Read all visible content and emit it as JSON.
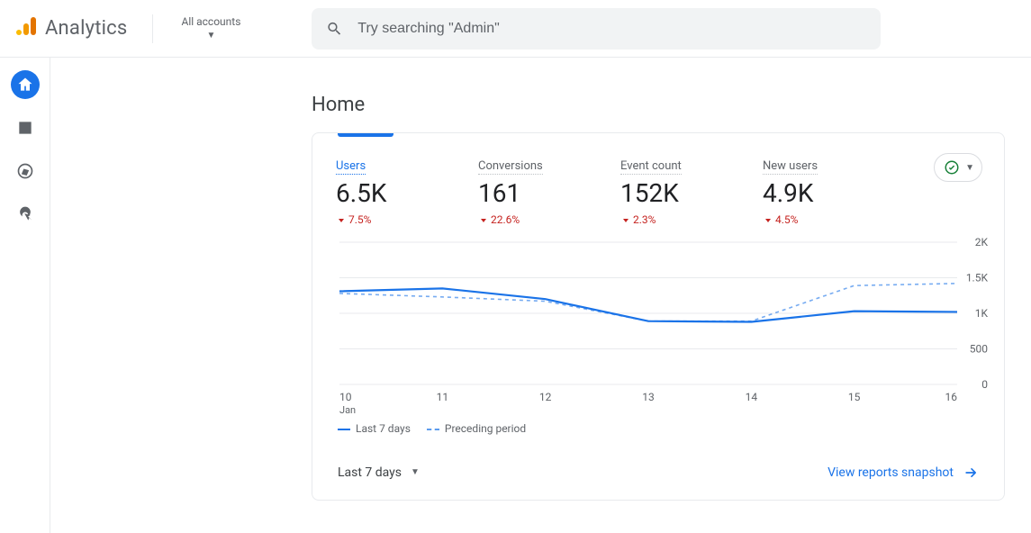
{
  "header": {
    "brand": "Analytics",
    "account_label": "All accounts",
    "search_placeholder": "Try searching \"Admin\""
  },
  "sidebar": {
    "items": [
      {
        "name": "home",
        "active": true
      },
      {
        "name": "reports",
        "active": false
      },
      {
        "name": "explore",
        "active": false
      },
      {
        "name": "advertising",
        "active": false
      }
    ]
  },
  "page": {
    "title": "Home"
  },
  "card": {
    "metrics": [
      {
        "label": "Users",
        "value": "6.5K",
        "delta": "7.5%",
        "direction": "down",
        "selected": true
      },
      {
        "label": "Conversions",
        "value": "161",
        "delta": "22.6%",
        "direction": "down",
        "selected": false
      },
      {
        "label": "Event count",
        "value": "152K",
        "delta": "2.3%",
        "direction": "down",
        "selected": false
      },
      {
        "label": "New users",
        "value": "4.9K",
        "delta": "4.5%",
        "direction": "down",
        "selected": false
      }
    ],
    "range_label": "Last 7 days",
    "snapshot_label": "View reports snapshot",
    "legend": {
      "current": "Last 7 days",
      "previous": "Preceding period"
    }
  },
  "chart_data": {
    "type": "line",
    "xlabel": "",
    "ylabel": "",
    "x_sub_label": "Jan",
    "ylim": [
      0,
      2000
    ],
    "yticks": [
      0,
      500,
      "1K",
      "1.5K",
      "2K"
    ],
    "ytick_values": [
      0,
      500,
      1000,
      1500,
      2000
    ],
    "categories": [
      "10",
      "11",
      "12",
      "13",
      "14",
      "15",
      "16"
    ],
    "series": [
      {
        "name": "Last 7 days",
        "values": [
          1310,
          1350,
          1200,
          890,
          880,
          1030,
          1020
        ],
        "style": "solid"
      },
      {
        "name": "Preceding period",
        "values": [
          1280,
          1230,
          1170,
          890,
          890,
          1390,
          1420
        ],
        "style": "dashed"
      }
    ]
  }
}
